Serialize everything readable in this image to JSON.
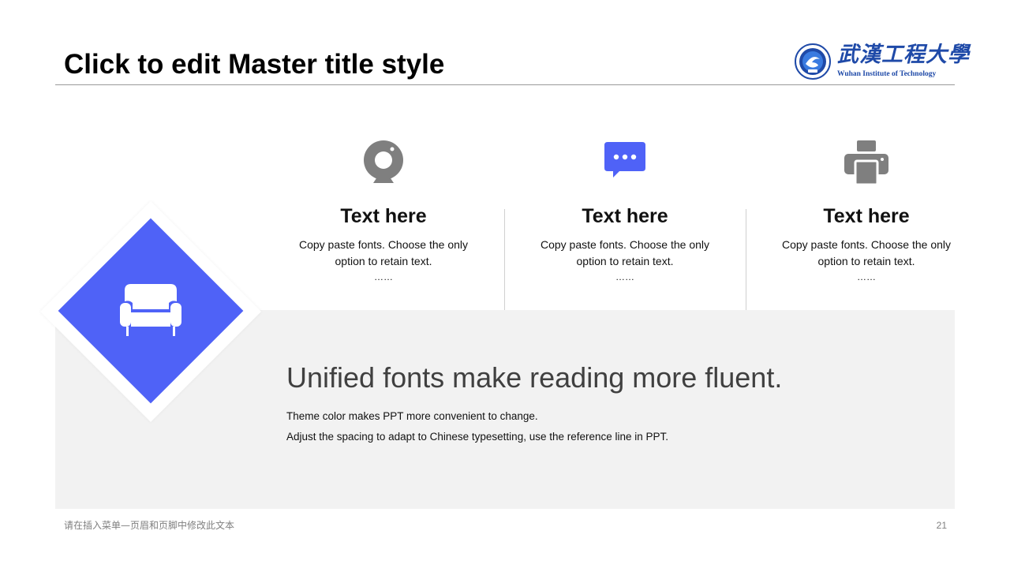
{
  "slide": {
    "title": "Click to edit Master title style",
    "logo": {
      "name_cn": "武漢工程大學",
      "name_en": "Wuhan Institute of Technology",
      "brand_color": "#1f4aa8"
    },
    "accent_color": "#4f62f7",
    "icon_gray": "#7f7f7f",
    "feature_icon": "sofa-icon",
    "columns": [
      {
        "icon": "webcam-icon",
        "title": "Text here",
        "body": "Copy paste fonts. Choose the only option to retain text.",
        "ellipsis": "……"
      },
      {
        "icon": "chat-bubble-icon",
        "title": "Text here",
        "body": "Copy paste fonts. Choose the only option to retain text.",
        "ellipsis": "……"
      },
      {
        "icon": "printer-icon",
        "title": "Text here",
        "body": "Copy paste fonts. Choose the only option to retain text.",
        "ellipsis": "……"
      }
    ],
    "headline": "Unified fonts make reading more fluent.",
    "sub_lines": [
      "Theme color makes PPT more convenient  to change.",
      "Adjust  the  spacing  to adapt to Chinese  typesetting,  use  the  reference  line  in  PPT."
    ],
    "footer_text": "请在插入菜单—页眉和页脚中修改此文本",
    "page_number": "21"
  }
}
